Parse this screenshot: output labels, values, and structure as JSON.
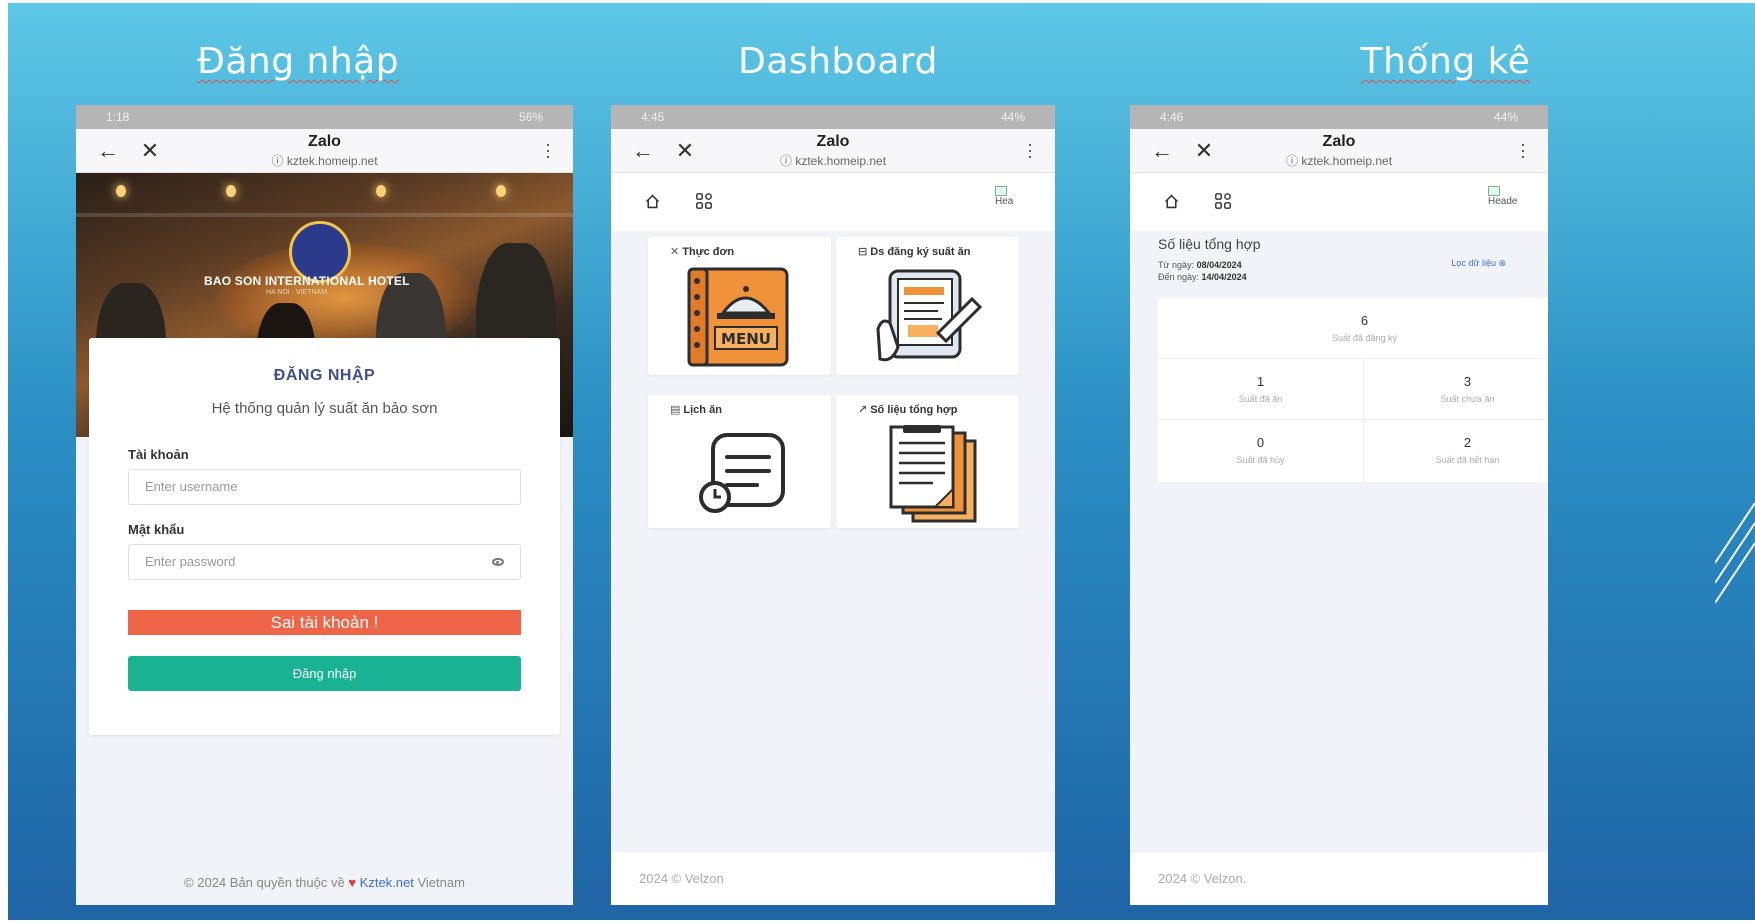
{
  "titles": {
    "login": "Đăng nhập",
    "dashboard": "Dashboard",
    "stats": "Thống kê"
  },
  "phones": {
    "login": {
      "time": "1:18",
      "battery": "56%"
    },
    "dashboard": {
      "time": "4:45",
      "battery": "44%"
    },
    "stats": {
      "time": "4:46",
      "battery": "44%"
    }
  },
  "zalo": {
    "app_name": "Zalo",
    "url": "kztek.homeip.net"
  },
  "login": {
    "hotel_name": "BAO SON INTERNATIONAL HOTEL",
    "hotel_sub": "HA NOI · VIETNAM",
    "heading": "ĐĂNG NHẬP",
    "subheading": "Hệ thống quản lý suất ăn bảo sơn",
    "username_label": "Tài khoản",
    "username_placeholder": "Enter username",
    "password_label": "Mật khẩu",
    "password_placeholder": "Enter password",
    "error_message": "Sai tài khoản !",
    "submit_label": "Đăng nhập",
    "footer_prefix": "© 2024 Bản quyền thuộc về",
    "footer_link": "Kztek.net",
    "footer_suffix": "Vietnam"
  },
  "dashboard": {
    "avatar_alt": "Hea",
    "tiles": [
      {
        "label": "Thực đơn",
        "icon": "menu-book-icon"
      },
      {
        "label": "Ds đăng ký suất ăn",
        "icon": "tablet-signup-icon"
      },
      {
        "label": "Lịch ăn",
        "icon": "schedule-icon"
      },
      {
        "label": "Số liệu tổng hợp",
        "icon": "documents-icon"
      }
    ],
    "menu_word": "MENU",
    "footer": "2024 © Velzon"
  },
  "stats": {
    "avatar_alt": "Heade",
    "title": "Số liệu tổng hợp",
    "from_label": "Từ ngày:",
    "from_date": "08/04/2024",
    "to_label": "Đến ngày:",
    "to_date": "14/04/2024",
    "filter_label": "Lọc dữ liệu ⊗",
    "total": {
      "value": "6",
      "label": "Suất đã đăng ký"
    },
    "cells": [
      {
        "value": "1",
        "label": "Suất đã ăn"
      },
      {
        "value": "3",
        "label": "Suất chưa ăn"
      },
      {
        "value": "0",
        "label": "Suất đã hủy"
      },
      {
        "value": "2",
        "label": "Suất đã hết hạn"
      }
    ],
    "footer": "2024 © Velzon."
  }
}
